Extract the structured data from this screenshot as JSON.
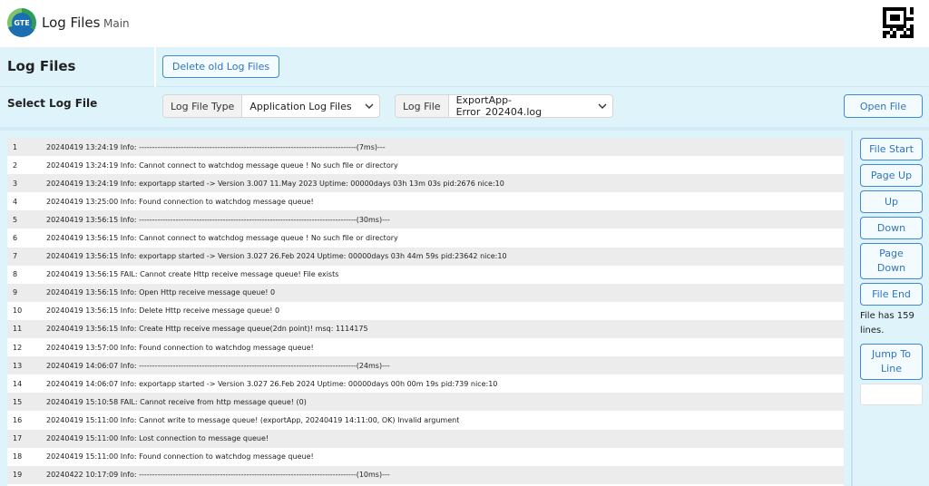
{
  "header": {
    "logo_text": "GTE",
    "app_title": "Log Files",
    "nav_main": "Main"
  },
  "section": {
    "title": "Log Files",
    "delete_button": "Delete old Log Files"
  },
  "select": {
    "title": "Select Log File",
    "type_label": "Log File Type",
    "type_value": "Application Log Files",
    "file_label": "Log File",
    "file_value": "ExportApp-Error_202404.log",
    "open_button": "Open File"
  },
  "nav": {
    "file_start": "File Start",
    "page_up": "Page Up",
    "up": "Up",
    "down": "Down",
    "page_down": "Page Down",
    "file_end": "File End",
    "file_info": "File has 159 lines.",
    "jump_to_line": "Jump To Line",
    "jump_value": ""
  },
  "log_rows": [
    {
      "num": "1",
      "text": "20240419 13:24:19 Info: -----------------------------------------------------------------------------------(7ms)---"
    },
    {
      "num": "2",
      "text": "20240419 13:24:19 Info: Cannot connect to watchdog message queue ! No such file or directory"
    },
    {
      "num": "3",
      "text": "20240419 13:24:19 Info: exportapp started -> Version 3.007 11.May 2023 Uptime: 00000days 03h 13m 03s pid:2676 nice:10"
    },
    {
      "num": "4",
      "text": "20240419 13:25:00 Info: Found connection to watchdog message queue!"
    },
    {
      "num": "5",
      "text": "20240419 13:56:15 Info: -----------------------------------------------------------------------------------(30ms)---"
    },
    {
      "num": "6",
      "text": "20240419 13:56:15 Info: Cannot connect to watchdog message queue ! No such file or directory"
    },
    {
      "num": "7",
      "text": "20240419 13:56:15 Info: exportapp started -> Version 3.027 26.Feb 2024 Uptime: 00000days 03h 44m 59s pid:23642 nice:10"
    },
    {
      "num": "8",
      "text": "20240419 13:56:15 FAIL: Cannot create Http receive message queue! File exists"
    },
    {
      "num": "9",
      "text": "20240419 13:56:15 Info: Open Http receive message queue! 0"
    },
    {
      "num": "10",
      "text": "20240419 13:56:15 Info: Delete Http receive message queue! 0"
    },
    {
      "num": "11",
      "text": "20240419 13:56:15 Info: Create Http receive message queue(2dn point)! msq: 1114175"
    },
    {
      "num": "12",
      "text": "20240419 13:57:00 Info: Found connection to watchdog message queue!"
    },
    {
      "num": "13",
      "text": "20240419 14:06:07 Info: -----------------------------------------------------------------------------------(24ms)---"
    },
    {
      "num": "14",
      "text": "20240419 14:06:07 Info: exportapp started -> Version 3.027 26.Feb 2024 Uptime: 00000days 00h 00m 19s pid:739 nice:10"
    },
    {
      "num": "15",
      "text": "20240419 15:10:58 FAIL: Cannot receive from http message queue! (0)"
    },
    {
      "num": "16",
      "text": "20240419 15:11:00 Info: Cannot write to message queue! (exportApp, 20240419 14:11:00, OK) Invalid argument"
    },
    {
      "num": "17",
      "text": "20240419 15:11:00 Info: Lost connection to message queue!"
    },
    {
      "num": "18",
      "text": "20240419 15:11:00 Info: Found connection to watchdog message queue!"
    },
    {
      "num": "19",
      "text": "20240422 10:17:09 Info: -----------------------------------------------------------------------------------(10ms)---"
    }
  ]
}
